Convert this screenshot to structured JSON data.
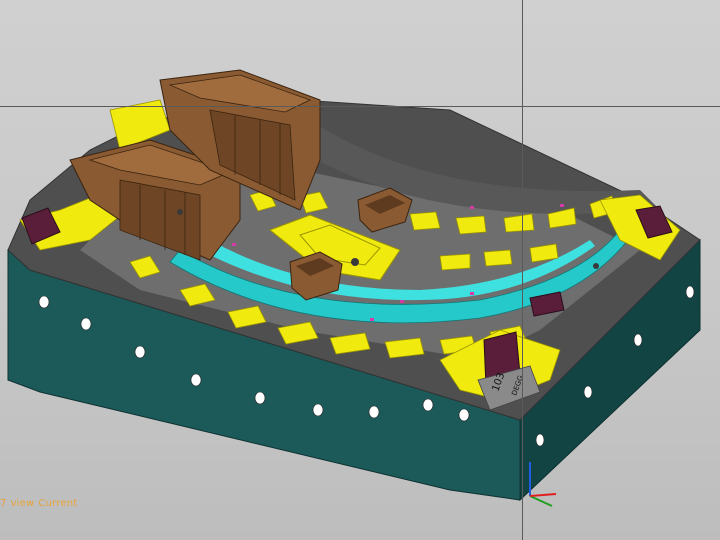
{
  "viewport": {
    "view_prefix": "7",
    "view_word": "view",
    "view_name": "Current"
  },
  "model": {
    "part_marking_number": "103",
    "part_marking_text": "DEGG",
    "colors": {
      "base": "#1c5a5a",
      "base_shade": "#134444",
      "floor": "#6e6e6e",
      "wall": "#585858",
      "pad": "#f1ea0e",
      "channel": "#26c9c9",
      "insert": "#8a5a32",
      "insert_dark": "#5e3b1f",
      "pocket": "#5a1e3a",
      "magenta": "#d43aa8",
      "hole": "#ffffff"
    }
  },
  "triad": {
    "x_color": "#e02020",
    "y_color": "#20a020",
    "z_color": "#2060e0"
  }
}
